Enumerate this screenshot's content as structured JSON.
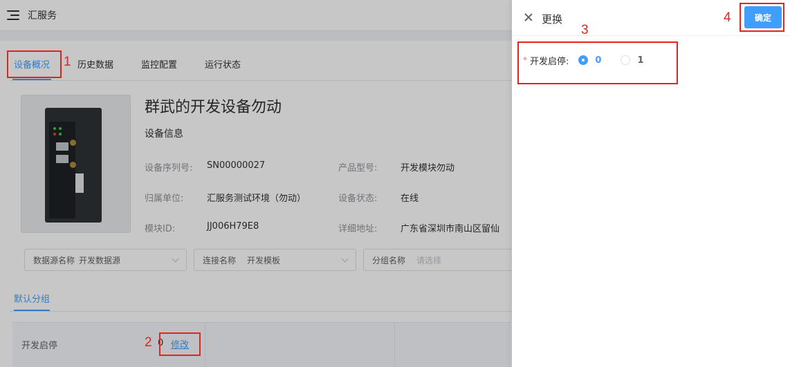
{
  "app": {
    "title": "汇服务"
  },
  "tabs": [
    {
      "label": "设备概况",
      "active": true
    },
    {
      "label": "历史数据",
      "active": false
    },
    {
      "label": "监控配置",
      "active": false
    },
    {
      "label": "运行状态",
      "active": false
    }
  ],
  "device": {
    "name": "群武的开发设备勿动",
    "info_title": "设备信息",
    "fields": [
      {
        "label": "设备序列号:",
        "value": "SN00000027"
      },
      {
        "label": "产品型号:",
        "value": "开发模块勿动"
      },
      {
        "label": "归属单位:",
        "value": "汇服务测试环境（勿动）"
      },
      {
        "label": "设备状态:",
        "value": "在线"
      },
      {
        "label": "模块ID:",
        "value": "JJ006H79E8"
      },
      {
        "label": "详细地址:",
        "value": "广东省深圳市南山区留仙"
      }
    ]
  },
  "filters": [
    {
      "label": "数据源名称",
      "value": "开发数据源"
    },
    {
      "label": "连接名称",
      "value": "开发模板"
    },
    {
      "label": "分组名称",
      "placeholder": "请选择"
    }
  ],
  "group": {
    "tab": "默认分组"
  },
  "param": {
    "label": "开发启停",
    "value": "0",
    "edit_label": "修改"
  },
  "drawer": {
    "title": "更换",
    "confirm_label": "确定",
    "form": {
      "required_mark": "*",
      "label": "开发启停:",
      "options": [
        {
          "label": "0",
          "checked": true
        },
        {
          "label": "1",
          "checked": false
        }
      ]
    }
  },
  "annotations": [
    "1",
    "2",
    "3",
    "4"
  ],
  "colors": {
    "accent": "#409eff",
    "annotation": "#e5231d"
  }
}
